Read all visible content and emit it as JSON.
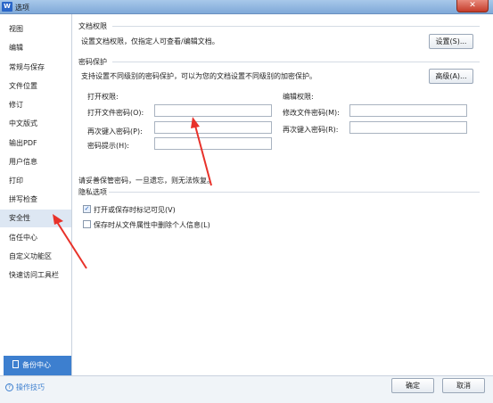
{
  "window": {
    "app_icon": "W",
    "title": "选项",
    "close_glyph": "✕"
  },
  "sidebar": {
    "items": [
      {
        "label": "视图"
      },
      {
        "label": "编辑"
      },
      {
        "label": "常规与保存"
      },
      {
        "label": "文件位置"
      },
      {
        "label": "修订"
      },
      {
        "label": "中文版式"
      },
      {
        "label": "输出PDF"
      },
      {
        "label": "用户信息"
      },
      {
        "label": "打印"
      },
      {
        "label": "拼写检查"
      },
      {
        "label": "安全性"
      },
      {
        "label": "信任中心"
      },
      {
        "label": "自定义功能区"
      },
      {
        "label": "快速访问工具栏"
      }
    ],
    "active_item": "安全性",
    "backup_label": "备份中心"
  },
  "doc_permission": {
    "title": "文档权限",
    "description": "设置文档权限，仅指定人可查看/编辑文档。",
    "settings_button": "设置(S)..."
  },
  "password": {
    "title": "密码保护",
    "description": "支持设置不同级别的密码保护，可以为您的文档设置不同级别的加密保护。",
    "advanced_button": "高级(A)...",
    "open_heading": "打开权限:",
    "open_password_label": "打开文件密码(O):",
    "open_password_value": "",
    "open_confirm_label": "再次键入密码(P):",
    "open_confirm_value": "",
    "hint_label": "密码提示(H):",
    "hint_value": "",
    "edit_heading": "编辑权限:",
    "edit_password_label": "修改文件密码(M):",
    "edit_password_value": "",
    "edit_confirm_label": "再次键入密码(R):",
    "edit_confirm_value": "",
    "warning": "请妥善保管密码，一旦遗忘，则无法恢复。"
  },
  "privacy": {
    "title": "隐私选项",
    "option1_label": "打开或保存时标记可见(V)",
    "option1_checked": true,
    "option1_glyph": "✓",
    "option2_label": "保存时从文件属性中删除个人信息(L)",
    "option2_checked": false
  },
  "footer": {
    "tips_label": "操作技巧",
    "tips_icon_glyph": "?",
    "ok_button": "确定",
    "cancel_button": "取消"
  },
  "colors": {
    "accent": "#3d7fcf",
    "annotation_arrow": "#e8322a",
    "active_nav_bg": "#dde7f3"
  }
}
